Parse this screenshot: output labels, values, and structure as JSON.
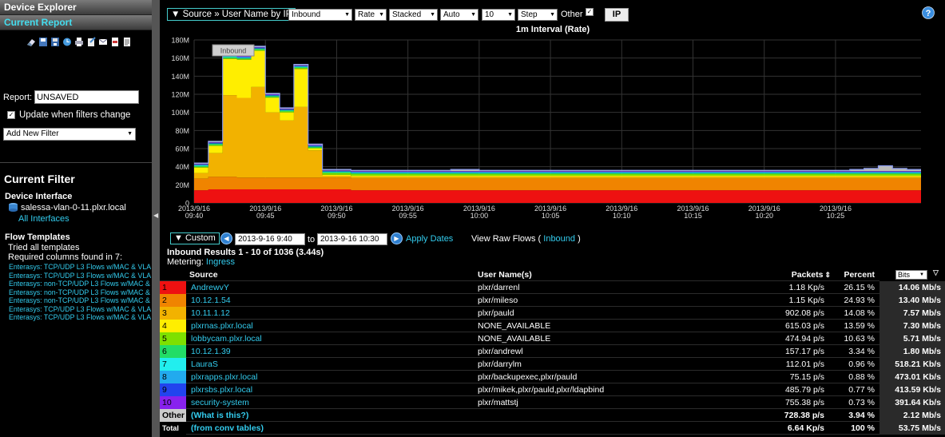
{
  "sidebar": {
    "device_explorer": "Device Explorer",
    "current_report": "Current Report",
    "report_label": "Report:",
    "report_value": "UNSAVED",
    "update_label": "Update when filters change",
    "add_filter": "Add New Filter",
    "current_filter_title": "Current Filter",
    "device_interface_label": "Device Interface",
    "device_name": "salessa-vlan-0-11.plxr.local",
    "all_interfaces": "All Interfaces",
    "flow_templates_label": "Flow Templates",
    "tried_templates": "Tried all templates",
    "required_columns": "Required columns found in 7:",
    "flow_templates": [
      "Enterasys: TCP/UDP L3 Flows w/MAC & VLA",
      "Enterasys: TCP/UDP L3 Flows w/MAC & VLA",
      "Enterasys: non-TCP/UDP L3 Flows w/MAC &",
      "Enterasys: non-TCP/UDP L3 Flows w/MAC &",
      "Enterasys: non-TCP/UDP L3 Flows w/MAC &",
      "Enterasys: TCP/UDP L3 Flows w/MAC & VLA",
      "Enterasys: TCP/UDP L3 Flows w/MAC & VLA"
    ]
  },
  "controls": {
    "source": "▼ Source » User Name by IP",
    "direction": "Inbound",
    "mode": "Rate",
    "stack": "Stacked",
    "scale": "Auto",
    "count": "10",
    "line": "Step",
    "other_label": "Other",
    "ip_button": "IP",
    "chart_title": "1m Interval (Rate)"
  },
  "dates": {
    "custom": "▼  Custom",
    "from": "2013-9-16 9:40",
    "to_label": "to",
    "to": "2013-9-16 10:30",
    "apply": "Apply Dates",
    "raw_flows_prefix": "View Raw Flows ( ",
    "raw_flows_link": "Inbound",
    "raw_flows_suffix": " )",
    "results_title": "Inbound Results 1 - 10 of 1036 (3.44s)",
    "metering_label": "Metering: ",
    "metering_value": "Ingress"
  },
  "table": {
    "headers": {
      "source": "Source",
      "user": "User Name(s)",
      "packets": "Packets",
      "percent": "Percent",
      "bits": "Bits"
    },
    "rows": [
      {
        "idx": "1",
        "color": "#ee1111",
        "source": "AndrewvY",
        "user": "plxr/darrenl",
        "packets": "1.18 Kp/s",
        "percent": "26.15 %",
        "bits": "14.06 Mb/s"
      },
      {
        "idx": "2",
        "color": "#f08400",
        "source": "10.12.1.54",
        "user": "plxr/mileso",
        "packets": "1.15 Kp/s",
        "percent": "24.93 %",
        "bits": "13.40 Mb/s"
      },
      {
        "idx": "3",
        "color": "#f2b200",
        "source": "10.11.1.12",
        "user": "plxr/pauld",
        "packets": "902.08 p/s",
        "percent": "14.08 %",
        "bits": "7.57 Mb/s"
      },
      {
        "idx": "4",
        "color": "#ffee00",
        "source": "plxrnas.plxr.local",
        "user": "NONE_AVAILABLE",
        "packets": "615.03 p/s",
        "percent": "13.59 %",
        "bits": "7.30 Mb/s"
      },
      {
        "idx": "5",
        "color": "#7ee000",
        "source": "lobbycam.plxr.local",
        "user": "NONE_AVAILABLE",
        "packets": "474.94 p/s",
        "percent": "10.63 %",
        "bits": "5.71 Mb/s"
      },
      {
        "idx": "6",
        "color": "#22dd66",
        "source": "10.12.1.39",
        "user": "plxr/andrewl",
        "packets": "157.17 p/s",
        "percent": "3.34 %",
        "bits": "1.80 Mb/s"
      },
      {
        "idx": "7",
        "color": "#22eeee",
        "source": "LauraS",
        "user": "plxr/darrylm",
        "packets": "112.01 p/s",
        "percent": "0.96 %",
        "bits": "518.21 Kb/s"
      },
      {
        "idx": "8",
        "color": "#22aaee",
        "source": "plxrapps.plxr.local",
        "user": "plxr/backupexec,plxr/pauld",
        "packets": "75.15 p/s",
        "percent": "0.88 %",
        "bits": "473.01 Kb/s"
      },
      {
        "idx": "9",
        "color": "#2244ee",
        "source": "plxrsbs.plxr.local",
        "user": "plxr/mikek,plxr/pauld,plxr/ldapbind",
        "packets": "485.79 p/s",
        "percent": "0.77 %",
        "bits": "413.59 Kb/s"
      },
      {
        "idx": "10",
        "color": "#8822ee",
        "source": "security-system",
        "user": "plxr/mattstj",
        "packets": "755.38 p/s",
        "percent": "0.73 %",
        "bits": "391.64 Kb/s"
      }
    ],
    "other": {
      "idx": "Other",
      "source": "(What is this?)",
      "packets": "728.38 p/s",
      "percent": "3.94 %",
      "bits": "2.12 Mb/s"
    },
    "total": {
      "idx": "Total",
      "source": "(from conv tables)",
      "packets": "6.64 Kp/s",
      "percent": "100 %",
      "bits": "53.75 Mb/s"
    }
  },
  "chart_data": {
    "type": "area",
    "stacked": true,
    "tooltip_label": "Inbound",
    "y_ticks": [
      "0",
      "20M",
      "40M",
      "60M",
      "80M",
      "100M",
      "120M",
      "140M",
      "160M",
      "180M"
    ],
    "ylim": [
      0,
      180
    ],
    "x_ticks": [
      [
        "2013/9/16",
        "09:40"
      ],
      [
        "2013/9/16",
        "09:45"
      ],
      [
        "2013/9/16",
        "09:50"
      ],
      [
        "2013/9/16",
        "09:55"
      ],
      [
        "2013/9/16",
        "10:00"
      ],
      [
        "2013/9/16",
        "10:05"
      ],
      [
        "2013/9/16",
        "10:10"
      ],
      [
        "2013/9/16",
        "10:15"
      ],
      [
        "2013/9/16",
        "10:20"
      ],
      [
        "2013/9/16",
        "10:25"
      ]
    ],
    "minutes": 51,
    "series": [
      {
        "name": "AndrewvY",
        "color": "#ee1111",
        "values": [
          14,
          15,
          15,
          15,
          15,
          15,
          15,
          15,
          15,
          15,
          15,
          14,
          14,
          14,
          14,
          14,
          14,
          14,
          14,
          14,
          14,
          14,
          14,
          14,
          14,
          14,
          14,
          14,
          14,
          14,
          14,
          14,
          14,
          14,
          14,
          14,
          14,
          14,
          14,
          14,
          14,
          14,
          14,
          14,
          14,
          14,
          14,
          14,
          14,
          14,
          14
        ]
      },
      {
        "name": "10.12.1.54",
        "color": "#f08400",
        "values": [
          13,
          14,
          14,
          13,
          13,
          13,
          13,
          13,
          13,
          13,
          13,
          13,
          13,
          13,
          13,
          13,
          13,
          13,
          13,
          13,
          13,
          13,
          13,
          13,
          13,
          13,
          13,
          13,
          13,
          13,
          13,
          13,
          13,
          13,
          13,
          13,
          13,
          13,
          13,
          13,
          13,
          13,
          13,
          13,
          13,
          13,
          13,
          13,
          13,
          13,
          13
        ]
      },
      {
        "name": "10.11.1.12",
        "color": "#f2b200",
        "values": [
          6,
          26,
          90,
          88,
          100,
          72,
          63,
          78,
          30,
          2,
          2,
          2,
          2,
          2,
          2,
          2,
          2,
          2,
          2,
          2,
          2,
          2,
          2,
          2,
          2,
          2,
          2,
          2,
          2,
          2,
          2,
          2,
          2,
          2,
          2,
          2,
          2,
          2,
          2,
          2,
          2,
          2,
          2,
          2,
          2,
          2,
          2,
          2,
          2,
          2,
          2
        ]
      },
      {
        "name": "plxrnas.plxr.local",
        "color": "#ffee00",
        "values": [
          6,
          8,
          40,
          42,
          40,
          16,
          9,
          42,
          2,
          1,
          1,
          1,
          1,
          1,
          1,
          1,
          1,
          1,
          1,
          1,
          1,
          1,
          1,
          1,
          1,
          1,
          1,
          1,
          1,
          1,
          1,
          1,
          1,
          1,
          1,
          1,
          1,
          1,
          1,
          1,
          1,
          1,
          1,
          1,
          1,
          1,
          1,
          1,
          1,
          1,
          1
        ]
      },
      {
        "name": "lobbycam.plxr.local",
        "color": "#7ee000",
        "values": [
          1,
          1,
          1,
          1,
          1,
          1,
          1,
          1,
          1,
          2,
          2,
          2,
          2,
          2,
          2,
          2,
          2,
          2,
          2,
          2,
          2,
          2,
          2,
          2,
          2,
          2,
          2,
          2,
          2,
          2,
          2,
          2,
          2,
          2,
          2,
          2,
          2,
          2,
          2,
          2,
          2,
          2,
          2,
          2,
          2,
          2,
          2,
          2,
          2,
          2,
          2
        ]
      },
      {
        "name": "10.12.1.39",
        "color": "#22dd66",
        "values": [
          1,
          1,
          1,
          1,
          1,
          1,
          1,
          1,
          1,
          1,
          1,
          1,
          1,
          1,
          1,
          1,
          1,
          1,
          1,
          1,
          1,
          1,
          1,
          1,
          1,
          1,
          1,
          1,
          1,
          1,
          1,
          1,
          1,
          1,
          1,
          1,
          1,
          1,
          1,
          1,
          1,
          1,
          1,
          1,
          1,
          1,
          1,
          1,
          1,
          1,
          1
        ]
      },
      {
        "name": "LauraS",
        "color": "#22eeee",
        "values": [
          0.5,
          0.5,
          0.5,
          0.5,
          0.5,
          0.5,
          0.5,
          0.5,
          0.5,
          0.5,
          0.5,
          0.5,
          0.5,
          0.5,
          0.5,
          0.5,
          0.5,
          0.5,
          0.5,
          0.5,
          0.5,
          0.5,
          0.5,
          0.5,
          0.5,
          0.5,
          0.5,
          0.5,
          0.5,
          0.5,
          0.5,
          0.5,
          0.5,
          0.5,
          0.5,
          0.5,
          0.5,
          0.5,
          0.5,
          0.5,
          0.5,
          0.5,
          0.5,
          0.5,
          0.5,
          0.5,
          0.5,
          0.5,
          0.5,
          0.5,
          0.5
        ]
      },
      {
        "name": "plxrapps.plxr.local",
        "color": "#22aaee",
        "values": [
          0.5,
          0.5,
          0.5,
          0.5,
          0.5,
          0.5,
          0.5,
          0.5,
          0.5,
          0.5,
          0.5,
          0.5,
          0.5,
          0.5,
          0.5,
          0.5,
          0.5,
          0.5,
          0.5,
          0.5,
          0.5,
          0.5,
          0.5,
          0.5,
          0.5,
          0.5,
          0.5,
          0.5,
          0.5,
          0.5,
          0.5,
          0.5,
          0.5,
          0.5,
          0.5,
          0.5,
          0.5,
          0.5,
          0.5,
          0.5,
          0.5,
          0.5,
          0.5,
          0.5,
          0.5,
          0.5,
          0.5,
          0.5,
          0.5,
          0.5,
          0.5
        ]
      },
      {
        "name": "plxrsbs.plxr.local",
        "color": "#2244ee",
        "values": [
          0.5,
          0.5,
          0.5,
          0.5,
          0.5,
          0.5,
          0.5,
          0.5,
          0.5,
          0.5,
          0.5,
          0.5,
          0.5,
          0.5,
          0.5,
          0.5,
          0.5,
          0.5,
          0.5,
          0.5,
          0.5,
          0.5,
          0.5,
          0.5,
          0.5,
          0.5,
          0.5,
          0.5,
          0.5,
          0.5,
          0.5,
          0.5,
          0.5,
          0.5,
          0.5,
          0.5,
          0.5,
          0.5,
          0.5,
          0.5,
          0.5,
          0.5,
          0.5,
          0.5,
          0.5,
          0.5,
          0.5,
          0.5,
          0.5,
          0.5,
          0.5
        ]
      },
      {
        "name": "security-system",
        "color": "#8822ee",
        "values": [
          0.5,
          0.5,
          0.5,
          0.5,
          0.5,
          0.5,
          0.5,
          0.5,
          0.5,
          0.5,
          0.5,
          0.5,
          0.5,
          0.5,
          0.5,
          0.5,
          0.5,
          0.5,
          0.5,
          0.5,
          0.5,
          0.5,
          0.5,
          0.5,
          0.5,
          0.5,
          0.5,
          0.5,
          0.5,
          0.5,
          0.5,
          0.5,
          0.5,
          0.5,
          0.5,
          0.5,
          0.5,
          0.5,
          0.5,
          0.5,
          0.5,
          0.5,
          0.5,
          0.5,
          0.5,
          0.5,
          0.5,
          0.5,
          0.5,
          0.5,
          0.5
        ]
      },
      {
        "name": "Other",
        "color": "#bbbbbb",
        "values": [
          1,
          1,
          1,
          1,
          1,
          1,
          1,
          1,
          1,
          1,
          1,
          1,
          1,
          1,
          1,
          1,
          1,
          1,
          2,
          2,
          1,
          1,
          1,
          1,
          1,
          1,
          1,
          1,
          1,
          1,
          1,
          1,
          1,
          1,
          1,
          1,
          1,
          1,
          1,
          1,
          1,
          1,
          1,
          1,
          1,
          1,
          2,
          3,
          6,
          3,
          2
        ]
      }
    ]
  }
}
